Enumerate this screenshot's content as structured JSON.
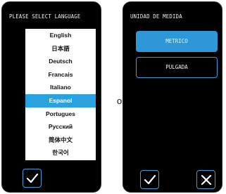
{
  "language_panel": {
    "title": "PLEASE SELECT LANGUAGE",
    "languages": [
      "English",
      "日本語",
      "Deutsch",
      "Francais",
      "Italiano",
      "Espanol",
      "Portugues",
      "Русский",
      "简体中文",
      "한국어"
    ],
    "selected": "Espanol",
    "ok_icon": "check-icon"
  },
  "unit_panel": {
    "title": "UNIDAD DE MEDIDA",
    "options": [
      "METRICO",
      "PULGADA"
    ],
    "selected": "METRICO",
    "ok_icon": "check-icon",
    "cancel_icon": "close-icon"
  },
  "side_text": "o",
  "colors": {
    "accent": "#29a3e0",
    "panel_bg": "#000000",
    "border": "#3a9fd8"
  }
}
